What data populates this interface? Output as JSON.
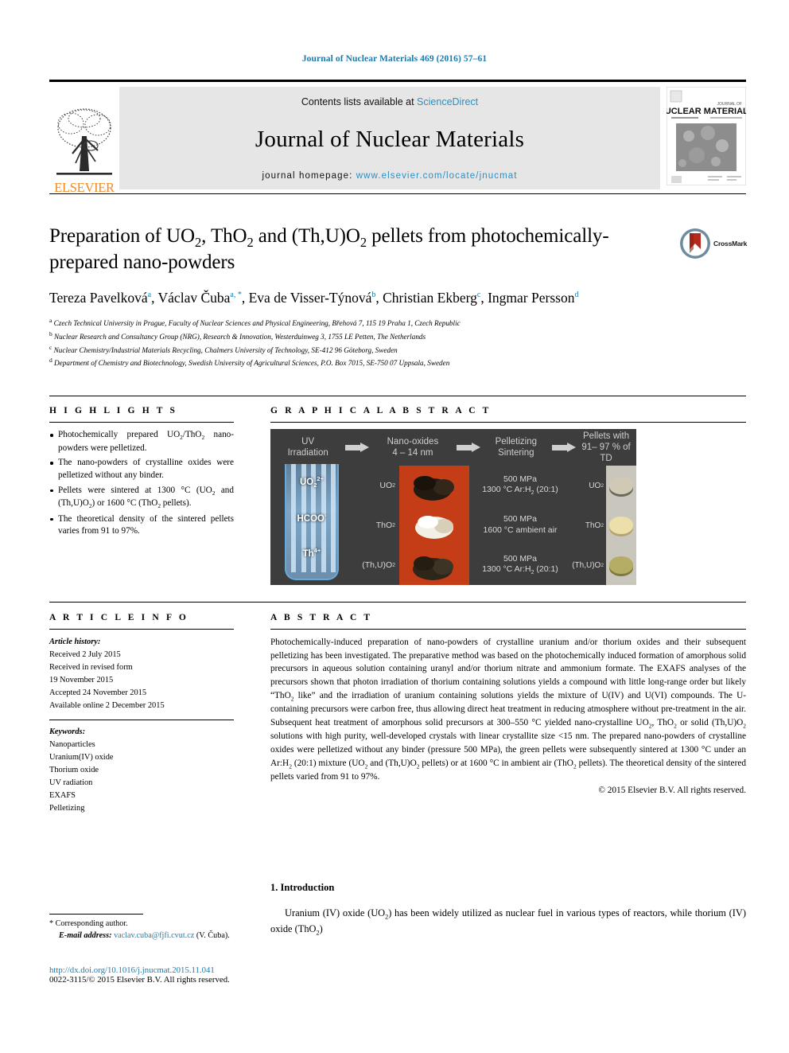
{
  "running_head": "Journal of Nuclear Materials 469 (2016) 57–61",
  "masthead": {
    "publisher": "ELSEVIER",
    "contents_prefix": "Contents lists available at ",
    "contents_link": "ScienceDirect",
    "journal_name": "Journal of Nuclear Materials",
    "homepage_prefix": "journal homepage: ",
    "homepage_url": "www.elsevier.com/locate/jnucmat",
    "cover_title_line1": "JOURNAL OF",
    "cover_title_line2": "NUCLEAR MATERIALS"
  },
  "article": {
    "title": "Preparation of UO2, ThO2 and (Th,U)O2 pellets from photochemically-prepared nano-powders",
    "crossmark_label": "CrossMark",
    "authors": [
      {
        "name": "Tereza Pavelková",
        "marks": "a"
      },
      {
        "name": "Václav Čuba",
        "marks": "a, *"
      },
      {
        "name": "Eva de Visser-Týnová",
        "marks": "b"
      },
      {
        "name": "Christian Ekberg",
        "marks": "c"
      },
      {
        "name": "Ingmar Persson",
        "marks": "d"
      }
    ],
    "affiliations": [
      {
        "mark": "a",
        "text": "Czech Technical University in Prague, Faculty of Nuclear Sciences and Physical Engineering, Břehová 7, 115 19 Praha 1, Czech Republic"
      },
      {
        "mark": "b",
        "text": "Nuclear Research and Consultancy Group (NRG), Research & Innovation, Westerduinweg 3, 1755 LE Petten, The Netherlands"
      },
      {
        "mark": "c",
        "text": "Nuclear Chemistry/Industrial Materials Recycling, Chalmers University of Technology, SE-412 96 Göteborg, Sweden"
      },
      {
        "mark": "d",
        "text": "Department of Chemistry and Biotechnology, Swedish University of Agricultural Sciences, P.O. Box 7015, SE-750 07 Uppsala, Sweden"
      }
    ]
  },
  "highlights": {
    "heading": "H I G H L I G H T S",
    "items": [
      "Photochemically prepared UO2/ThO2 nano-powders were pelletized.",
      "The nano-powders of crystalline oxides were pelletized without any binder.",
      "Pellets were sintered at 1300 °C (UO2 and (Th,U)O2) or 1600 °C (ThO2 pellets).",
      "The theoretical density of the sintered pellets varies from 91 to 97%."
    ]
  },
  "graphical_abstract": {
    "heading": "G R A P H I C A L   A B S T R A C T",
    "stages": [
      "UV\nIrradiation",
      "Nano-oxides\n4 – 14 nm",
      "Pelletizing\nSintering",
      "Pellets with\n91– 97 % of TD"
    ],
    "stage_uv": {
      "line1": "UV",
      "line2": "Irradiation"
    },
    "stage_nano": {
      "line1": "Nano-oxides",
      "line2": "4 – 14 nm"
    },
    "stage_pellet": {
      "line1": "Pelletizing",
      "line2": "Sintering"
    },
    "stage_td": {
      "line1": "Pellets with",
      "line2": "91– 97 % of TD"
    },
    "solution_species": [
      "UO2 2+",
      "HCOO–",
      "Th4+"
    ],
    "rows": [
      {
        "powder_label": "UO2",
        "conditions_line1": "500 MPa",
        "conditions_line2": "1300 °C Ar:H2 (20:1)",
        "pellet_label": "UO2",
        "powder_color": "#2a2018",
        "pellet_color": "#cfc9b6"
      },
      {
        "powder_label": "ThO2",
        "conditions_line1": "500 MPa",
        "conditions_line2": "1600 °C ambient air",
        "pellet_label": "ThO2",
        "powder_color": "#efece1",
        "pellet_color": "#e8d8a4"
      },
      {
        "powder_label": "(Th,U)O2",
        "conditions_line1": "500 MPa",
        "conditions_line2": "1300 °C Ar:H2 (20:1)",
        "pellet_label": "(Th,U)O2",
        "powder_color": "#3a3124",
        "pellet_color": "#b5ad63"
      }
    ]
  },
  "article_info": {
    "heading": "A R T I C L E   I N F O",
    "history_label": "Article history:",
    "history": [
      "Received 2 July 2015",
      "Received in revised form",
      "19 November 2015",
      "Accepted 24 November 2015",
      "Available online 2 December 2015"
    ],
    "keywords_label": "Keywords:",
    "keywords": [
      "Nanoparticles",
      "Uranium(IV) oxide",
      "Thorium oxide",
      "UV radiation",
      "EXAFS",
      "Pelletizing"
    ]
  },
  "abstract": {
    "heading": "A B S T R A C T",
    "text": "Photochemically-induced preparation of nano-powders of crystalline uranium and/or thorium oxides and their subsequent pelletizing has been investigated. The preparative method was based on the photochemically induced formation of amorphous solid precursors in aqueous solution containing uranyl and/or thorium nitrate and ammonium formate. The EXAFS analyses of the precursors shown that photon irradiation of thorium containing solutions yields a compound with little long-range order but likely “ThO2 like” and the irradiation of uranium containing solutions yields the mixture of U(IV) and U(VI) compounds. The U-containing precursors were carbon free, thus allowing direct heat treatment in reducing atmosphere without pre-treatment in the air. Subsequent heat treatment of amorphous solid precursors at 300–550 °C yielded nano-crystalline UO2, ThO2 or solid (Th,U)O2 solutions with high purity, well-developed crystals with linear crystallite size <15 nm. The prepared nano-powders of crystalline oxides were pelletized without any binder (pressure 500 MPa), the green pellets were subsequently sintered at 1300 °C under an Ar:H2 (20:1) mixture (UO2 and (Th,U)O2 pellets) or at 1600 °C in ambient air (ThO2 pellets). The theoretical density of the sintered pellets varied from 91 to 97%.",
    "copyright": "© 2015 Elsevier B.V. All rights reserved."
  },
  "introduction": {
    "heading": "1.  Introduction",
    "paragraph": "Uranium (IV) oxide (UO2) has been widely utilized as nuclear fuel in various types of reactors, while thorium (IV) oxide (ThO2)"
  },
  "footer": {
    "corresponding_marker": "*",
    "corresponding_label": "Corresponding author.",
    "email_label": "E-mail address:",
    "email": "vaclav.cuba@fjfi.cvut.cz",
    "email_suffix": "(V. Čuba).",
    "doi": "http://dx.doi.org/10.1016/j.jnucmat.2015.11.041",
    "issn": "0022-3115/© 2015 Elsevier B.V. All rights reserved."
  },
  "colors": {
    "link_blue": "#1a7bb0",
    "sciencedirect_blue": "#2a8fc4",
    "elsevier_orange": "#f18a21",
    "figure_bg": "#3d3d3d"
  }
}
